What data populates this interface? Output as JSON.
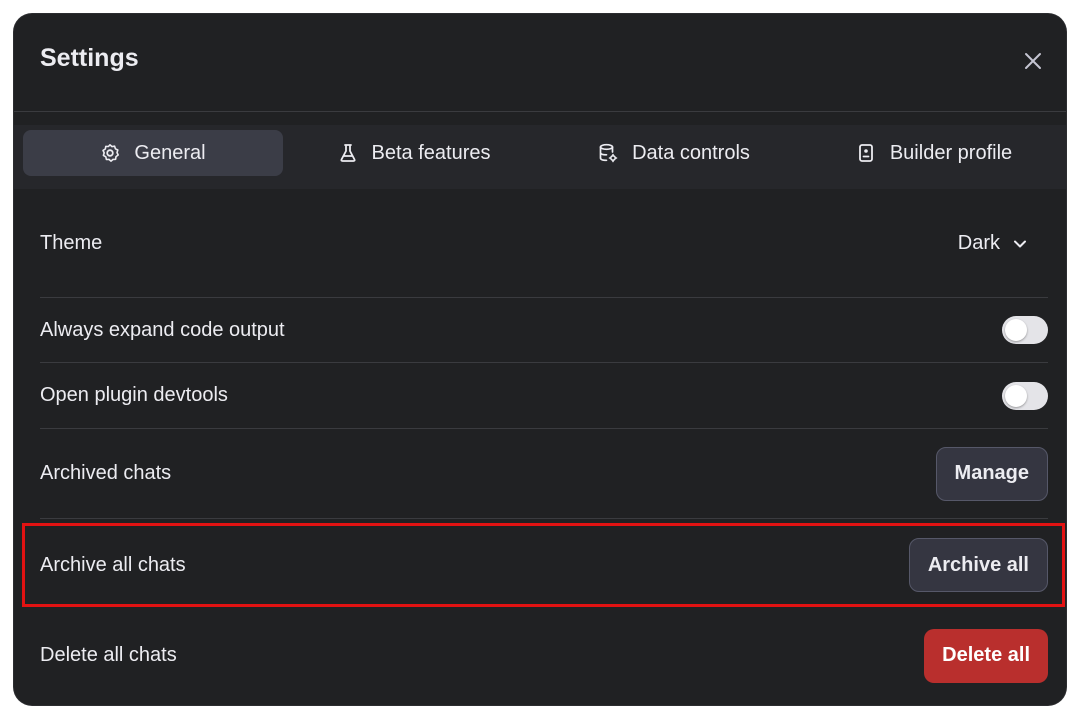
{
  "dialog": {
    "title": "Settings",
    "close_icon": "close-icon"
  },
  "tabs": [
    {
      "label": "General",
      "icon": "gear-icon",
      "active": true
    },
    {
      "label": "Beta features",
      "icon": "flask-icon",
      "active": false
    },
    {
      "label": "Data controls",
      "icon": "database-gear-icon",
      "active": false
    },
    {
      "label": "Builder profile",
      "icon": "id-badge-icon",
      "active": false
    }
  ],
  "settings": {
    "theme": {
      "label": "Theme",
      "value": "Dark"
    },
    "expand_code": {
      "label": "Always expand code output",
      "enabled": false
    },
    "plugin_devtools": {
      "label": "Open plugin devtools",
      "enabled": false
    },
    "archived_chats": {
      "label": "Archived chats",
      "button": "Manage"
    },
    "archive_all": {
      "label": "Archive all chats",
      "button": "Archive all"
    },
    "delete_all": {
      "label": "Delete all chats",
      "button": "Delete all"
    }
  },
  "colors": {
    "background": "#202123",
    "danger": "#b92f2d",
    "highlight": "#e21212"
  }
}
